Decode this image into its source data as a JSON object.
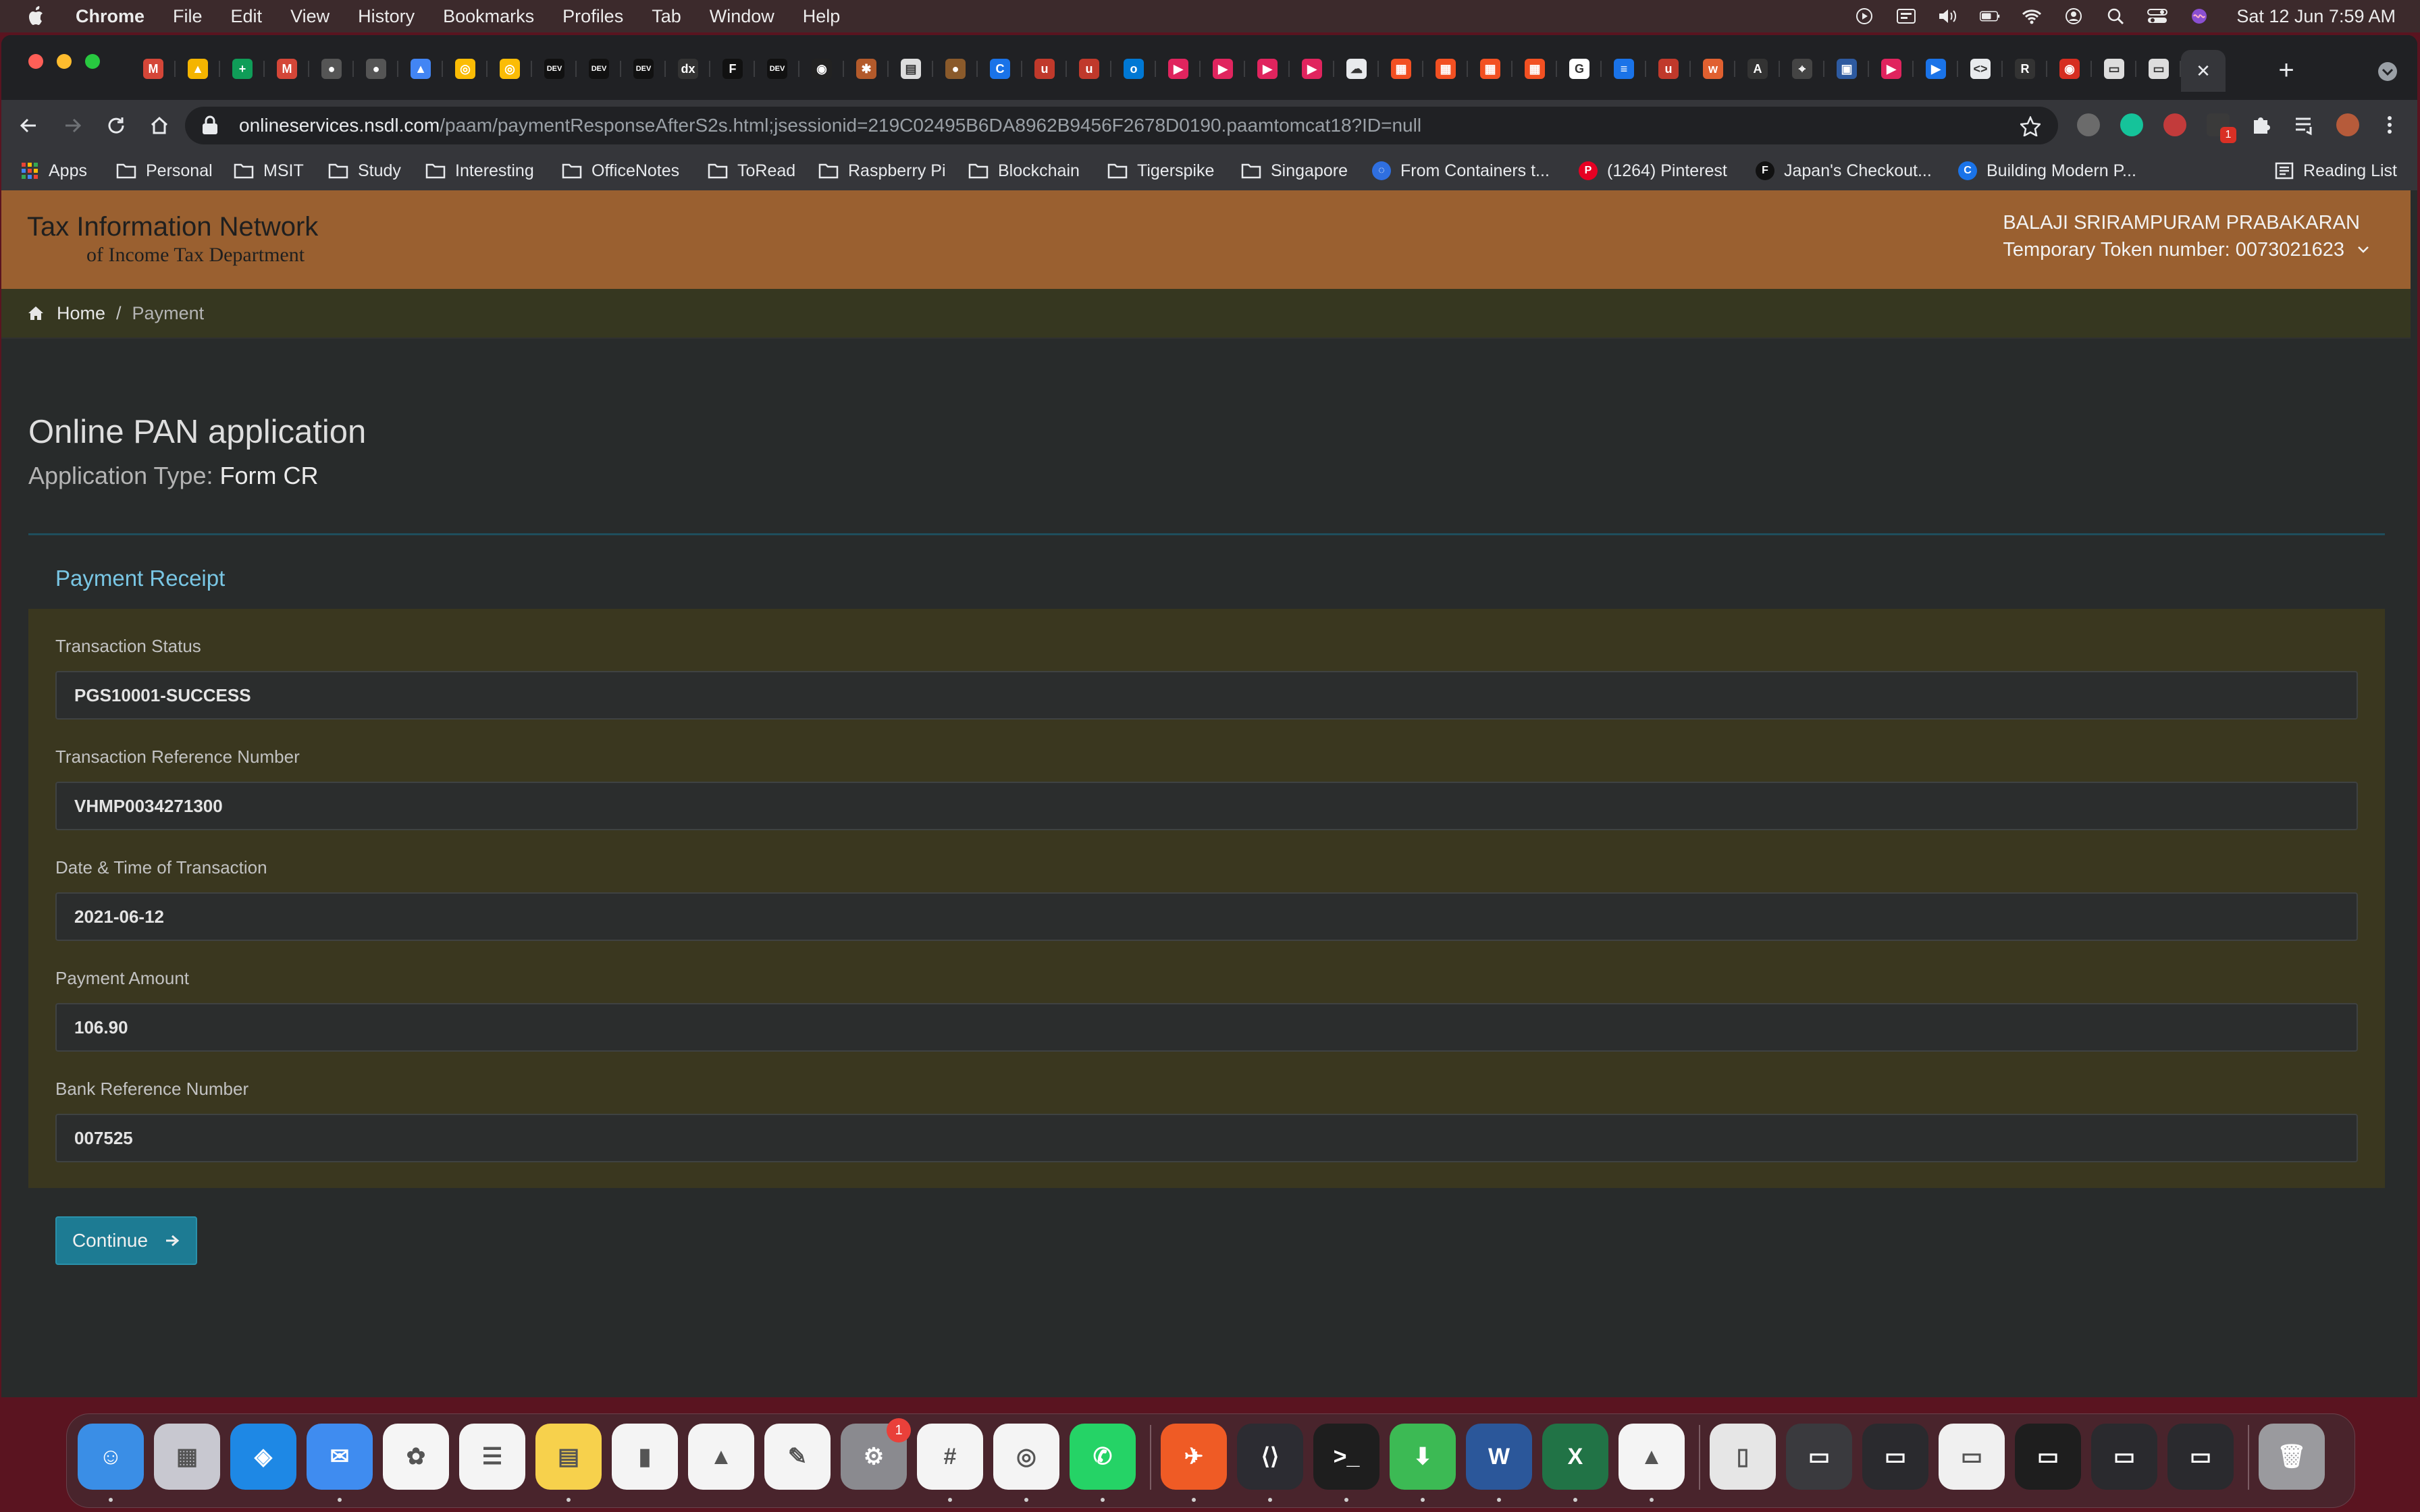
{
  "menubar": {
    "app_name": "Chrome",
    "items": [
      "File",
      "Edit",
      "View",
      "History",
      "Bookmarks",
      "Profiles",
      "Tab",
      "Window",
      "Help"
    ],
    "clock": "Sat 12 Jun  7:59 AM"
  },
  "browser": {
    "tab_favicons": [
      {
        "icon": "gmail-icon",
        "color": "#d44638",
        "glyph": "M"
      },
      {
        "icon": "drive-icon",
        "color": "#f4b400",
        "glyph": "▲"
      },
      {
        "icon": "sheets-icon",
        "color": "#0f9d58",
        "glyph": "+"
      },
      {
        "icon": "gmail-icon",
        "color": "#d44638",
        "glyph": "M"
      },
      {
        "icon": "dark-circle-icon",
        "color": "#555",
        "glyph": "●"
      },
      {
        "icon": "dark-circle-icon",
        "color": "#555",
        "glyph": "●"
      },
      {
        "icon": "drive-icon",
        "color": "#4285f4",
        "glyph": "▲"
      },
      {
        "icon": "chrome-icon",
        "color": "#fbbc05",
        "glyph": "◎"
      },
      {
        "icon": "chrome-icon",
        "color": "#fbbc05",
        "glyph": "◎"
      },
      {
        "icon": "dev-icon",
        "color": "#111",
        "glyph": "DEV"
      },
      {
        "icon": "dev-icon",
        "color": "#111",
        "glyph": "DEV"
      },
      {
        "icon": "dev-icon",
        "color": "#111",
        "glyph": "DEV"
      },
      {
        "icon": "x-icon",
        "color": "#333",
        "glyph": "dx"
      },
      {
        "icon": "f-icon",
        "color": "#111",
        "glyph": "F"
      },
      {
        "icon": "dev-icon",
        "color": "#111",
        "glyph": "DEV"
      },
      {
        "icon": "github-icon",
        "color": "#222",
        "glyph": "◉"
      },
      {
        "icon": "crab-icon",
        "color": "#b35a2b",
        "glyph": "✱"
      },
      {
        "icon": "page-icon",
        "color": "#ddd",
        "glyph": "▤"
      },
      {
        "icon": "brown-circle-icon",
        "color": "#8a5a2b",
        "glyph": "●"
      },
      {
        "icon": "c-icon",
        "color": "#1a73e8",
        "glyph": "C"
      },
      {
        "icon": "u-icon",
        "color": "#c0392b",
        "glyph": "u"
      },
      {
        "icon": "u-icon",
        "color": "#c0392b",
        "glyph": "u"
      },
      {
        "icon": "outlook-icon",
        "color": "#0078d4",
        "glyph": "o"
      },
      {
        "icon": "play-icon",
        "color": "#e0245e",
        "glyph": "▶"
      },
      {
        "icon": "play-icon",
        "color": "#e0245e",
        "glyph": "▶"
      },
      {
        "icon": "play-icon",
        "color": "#e0245e",
        "glyph": "▶"
      },
      {
        "icon": "play-icon",
        "color": "#e0245e",
        "glyph": "▶"
      },
      {
        "icon": "cloud-icon",
        "color": "#e8eaed",
        "glyph": "☁"
      },
      {
        "icon": "microsoft-icon",
        "color": "#f25022",
        "glyph": "▦"
      },
      {
        "icon": "microsoft-icon",
        "color": "#f25022",
        "glyph": "▦"
      },
      {
        "icon": "microsoft-icon",
        "color": "#f25022",
        "glyph": "▦"
      },
      {
        "icon": "microsoft-icon",
        "color": "#f25022",
        "glyph": "▦"
      },
      {
        "icon": "google-icon",
        "color": "#fff",
        "glyph": "G"
      },
      {
        "icon": "list-icon",
        "color": "#1a73e8",
        "glyph": "≡"
      },
      {
        "icon": "u-icon",
        "color": "#c0392b",
        "glyph": "u"
      },
      {
        "icon": "w-icon",
        "color": "#e06030",
        "glyph": "w"
      },
      {
        "icon": "a-circle-icon",
        "color": "#333",
        "glyph": "A"
      },
      {
        "icon": "pin-icon",
        "color": "#444",
        "glyph": "⌖"
      },
      {
        "icon": "image-icon",
        "color": "#2d5aa0",
        "glyph": "▣"
      },
      {
        "icon": "play-icon",
        "color": "#e0245e",
        "glyph": "▶"
      },
      {
        "icon": "video-icon",
        "color": "#1a73e8",
        "glyph": "▶"
      },
      {
        "icon": "code-icon",
        "color": "#e8eaed",
        "glyph": "<>"
      },
      {
        "icon": "r-icon",
        "color": "#333",
        "glyph": "R"
      },
      {
        "icon": "wifi-red-icon",
        "color": "#d62d20",
        "glyph": "◉"
      },
      {
        "icon": "page-red-icon",
        "color": "#ddd",
        "glyph": "▭"
      },
      {
        "icon": "page-red-icon",
        "color": "#ddd",
        "glyph": "▭"
      }
    ],
    "active_tab_close": "✕",
    "new_tab": "+",
    "url_host": "onlineservices.nsdl.com",
    "url_path": "/paam/paymentResponseAfterS2s.html;jsessionid=219C02495B6DA8962B9456F2678D0190.paamtomcat18?ID=null",
    "bookmarks": [
      {
        "label": "Apps",
        "kind": "apps"
      },
      {
        "label": "Personal",
        "kind": "folder"
      },
      {
        "label": "MSIT",
        "kind": "folder"
      },
      {
        "label": "Study",
        "kind": "folder"
      },
      {
        "label": "Interesting",
        "kind": "folder"
      },
      {
        "label": "OfficeNotes",
        "kind": "folder"
      },
      {
        "label": "ToRead",
        "kind": "folder"
      },
      {
        "label": "Raspberry Pi",
        "kind": "folder"
      },
      {
        "label": "Blockchain",
        "kind": "folder"
      },
      {
        "label": "Tigerspike",
        "kind": "folder"
      },
      {
        "label": "Singapore",
        "kind": "folder"
      },
      {
        "label": "From Containers t...",
        "kind": "site",
        "color": "#2f6fe0",
        "glyph": "◌"
      },
      {
        "label": "(1264) Pinterest",
        "kind": "site",
        "color": "#e60023",
        "glyph": "P"
      },
      {
        "label": "Japan's Checkout...",
        "kind": "site",
        "color": "#111",
        "glyph": "F"
      },
      {
        "label": "Building Modern P...",
        "kind": "site",
        "color": "#1a73e8",
        "glyph": "C"
      }
    ],
    "reading_list": "Reading List",
    "ext_badge": "1"
  },
  "site": {
    "logo_line1": "Tax Information Network",
    "logo_line2": "of Income Tax Department",
    "user_name": "BALAJI SRIRAMPURAM PRABAKARAN",
    "token_text": "Temporary Token number: 0073021623"
  },
  "breadcrumb": {
    "home": "Home",
    "separator": "/",
    "current": "Payment"
  },
  "main": {
    "title": "Online PAN application",
    "app_type_label": "Application Type:",
    "app_type_value": "Form CR",
    "receipt_heading": "Payment Receipt",
    "fields": [
      {
        "label": "Transaction Status",
        "value": "PGS10001-SUCCESS"
      },
      {
        "label": "Transaction Reference Number",
        "value": "VHMP0034271300"
      },
      {
        "label": "Date & Time of Transaction",
        "value": "2021-06-12"
      },
      {
        "label": "Payment Amount",
        "value": "106.90"
      },
      {
        "label": "Bank Reference Number",
        "value": "007525"
      }
    ],
    "continue_label": "Continue"
  },
  "dock": {
    "apps": [
      {
        "name": "finder",
        "color": "#3a8ee6",
        "glyph": "☺",
        "running": true
      },
      {
        "name": "launchpad",
        "color": "#c8c8d0",
        "glyph": "▦",
        "running": false
      },
      {
        "name": "safari",
        "color": "#1e88e5",
        "glyph": "◈",
        "running": false
      },
      {
        "name": "mail",
        "color": "#3f8cf0",
        "glyph": "✉",
        "running": true
      },
      {
        "name": "photos",
        "color": "#f5f5f5",
        "glyph": "✿",
        "running": false
      },
      {
        "name": "reminders",
        "color": "#f4f4f4",
        "glyph": "☰",
        "running": false
      },
      {
        "name": "notes",
        "color": "#f7d14c",
        "glyph": "▤",
        "running": true
      },
      {
        "name": "numbers",
        "color": "#f4f4f4",
        "glyph": "▮",
        "running": false
      },
      {
        "name": "keynote",
        "color": "#f4f4f4",
        "glyph": "▲",
        "running": false
      },
      {
        "name": "pages",
        "color": "#f4f4f4",
        "glyph": "✎",
        "running": false
      },
      {
        "name": "system-preferences",
        "color": "#8a8a8f",
        "glyph": "⚙",
        "running": false,
        "badge": "1"
      },
      {
        "name": "slack",
        "color": "#f4f4f4",
        "glyph": "#",
        "running": true
      },
      {
        "name": "chrome",
        "color": "#f4f4f4",
        "glyph": "◎",
        "running": true
      },
      {
        "name": "whatsapp",
        "color": "#25d366",
        "glyph": "✆",
        "running": true
      },
      {
        "name": "postman",
        "color": "#ef5b25",
        "glyph": "✈",
        "running": true
      },
      {
        "name": "vscode",
        "color": "#2c2c32",
        "glyph": "⟨⟩",
        "running": true
      },
      {
        "name": "terminal",
        "color": "#1e1e1e",
        "glyph": ">_",
        "running": true
      },
      {
        "name": "downloader",
        "color": "#3cba54",
        "glyph": "⬇",
        "running": true
      },
      {
        "name": "word",
        "color": "#2b579a",
        "glyph": "W",
        "running": true
      },
      {
        "name": "excel",
        "color": "#217346",
        "glyph": "X",
        "running": true
      },
      {
        "name": "google-drive",
        "color": "#f4f4f4",
        "glyph": "▲",
        "running": true
      },
      {
        "name": "pdf-document",
        "color": "#e6e6e6",
        "glyph": "▯",
        "running": false
      },
      {
        "name": "window-thumb",
        "color": "#3a3a3e",
        "glyph": "▭",
        "running": false
      },
      {
        "name": "window-thumb",
        "color": "#2a2a2e",
        "glyph": "▭",
        "running": false
      },
      {
        "name": "window-thumb",
        "color": "#f0f0f0",
        "glyph": "▭",
        "running": false
      },
      {
        "name": "window-thumb",
        "color": "#1e1e1e",
        "glyph": "▭",
        "running": false
      },
      {
        "name": "window-thumb",
        "color": "#2a2a2e",
        "glyph": "▭",
        "running": false
      },
      {
        "name": "window-thumb",
        "color": "#2a2a2e",
        "glyph": "▭",
        "running": false
      },
      {
        "name": "trash",
        "color": "#9a9a9e",
        "glyph": "🗑",
        "running": false
      }
    ]
  }
}
